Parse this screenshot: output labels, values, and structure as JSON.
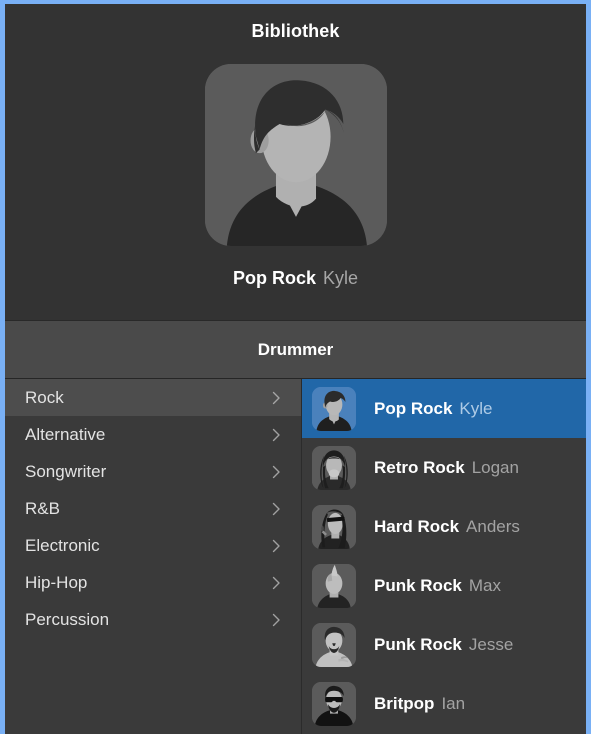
{
  "window": {
    "accent_focus_ring": "#79b0f5",
    "background": "#333333"
  },
  "library_header": {
    "title": "Bibliothek"
  },
  "preview": {
    "artwork_icon": "person-silhouette-avatar",
    "style": "Pop Rock",
    "player": "Kyle"
  },
  "instrument_header": {
    "title": "Drummer"
  },
  "categories": {
    "selected_index": 0,
    "disclosure_icon": "chevron-right-icon",
    "items": [
      {
        "label": "Rock"
      },
      {
        "label": "Alternative"
      },
      {
        "label": "Songwriter"
      },
      {
        "label": "R&B"
      },
      {
        "label": "Electronic"
      },
      {
        "label": "Hip-Hop"
      },
      {
        "label": "Percussion"
      }
    ]
  },
  "patches": {
    "selected_index": 0,
    "selection_color": "#2167a8",
    "items": [
      {
        "style": "Pop Rock",
        "player": "Kyle",
        "avatar": "avatar-kyle"
      },
      {
        "style": "Retro Rock",
        "player": "Logan",
        "avatar": "avatar-logan"
      },
      {
        "style": "Hard Rock",
        "player": "Anders",
        "avatar": "avatar-anders"
      },
      {
        "style": "Punk Rock",
        "player": "Max",
        "avatar": "avatar-max"
      },
      {
        "style": "Punk Rock",
        "player": "Jesse",
        "avatar": "avatar-jesse"
      },
      {
        "style": "Britpop",
        "player": "Ian",
        "avatar": "avatar-ian"
      }
    ]
  }
}
